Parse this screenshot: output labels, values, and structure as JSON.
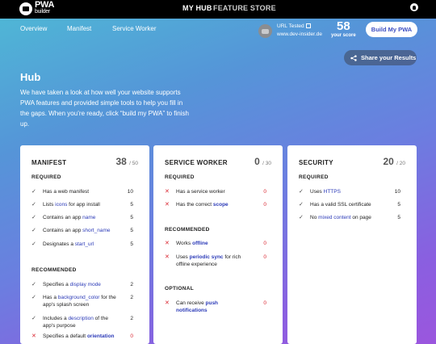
{
  "topbar": {
    "logo_main": "PWA",
    "logo_sub": "builder",
    "nav": [
      "MY HUB",
      "FEATURE STORE"
    ]
  },
  "subbar": {
    "nav": [
      "Overview",
      "Manifest",
      "Service Worker"
    ],
    "url_label": "URL Tested",
    "url_value": "www.dev-insider.de",
    "score_value": "58",
    "score_label": "your score",
    "build_label": "Build My PWA"
  },
  "hero": {
    "share_label": "Share your Results",
    "title": "Hub",
    "description": "We have taken a look at how well your website supports PWA features and provided simple tools to help you fill in the gaps. When you’re ready, click “build my PWA” to finish up."
  },
  "cards": {
    "manifest": {
      "title": "MANIFEST",
      "score": "38",
      "max": "/ 50",
      "required_label": "REQUIRED",
      "recommended_label": "RECOMMENDED",
      "required": [
        {
          "pre": "Has a web manifest",
          "link": "",
          "post": "",
          "pts": "10",
          "ok": true
        },
        {
          "pre": "Lists ",
          "link": "icons",
          "post": " for app install",
          "pts": "5",
          "ok": true
        },
        {
          "pre": "Contains an app ",
          "link": "name",
          "post": "",
          "pts": "5",
          "ok": true
        },
        {
          "pre": "Contains an app ",
          "link": "short_name",
          "post": "",
          "pts": "5",
          "ok": true
        },
        {
          "pre": "Designates a ",
          "link": "start_url",
          "post": "",
          "pts": "5",
          "ok": true
        }
      ],
      "recommended": [
        {
          "pre": "Specifies a ",
          "link": "display mode",
          "post": "",
          "pts": "2",
          "ok": true
        },
        {
          "pre": "Has a ",
          "link": "background_color",
          "post": " for the app's splash screen",
          "pts": "2",
          "ok": true
        },
        {
          "pre": "Includes a ",
          "link": "description",
          "post": " of the app's purpose",
          "pts": "2",
          "ok": true
        },
        {
          "pre": "Specifies a default ",
          "link": "orientation",
          "post": "",
          "pts": "0",
          "ok": false
        }
      ]
    },
    "service_worker": {
      "title": "SERVICE WORKER",
      "score": "0",
      "max": "/ 30",
      "required_label": "REQUIRED",
      "recommended_label": "RECOMMENDED",
      "optional_label": "OPTIONAL",
      "required": [
        {
          "pre": "Has a service worker",
          "link": "",
          "post": "",
          "pts": "0",
          "ok": false
        },
        {
          "pre": "Has the correct ",
          "link": "scope",
          "post": "",
          "pts": "0",
          "ok": false
        }
      ],
      "recommended": [
        {
          "pre": "Works ",
          "link": "offline",
          "post": "",
          "pts": "0",
          "ok": false
        },
        {
          "pre": "Uses ",
          "link": "periodic sync",
          "post": " for rich offline experience",
          "pts": "0",
          "ok": false
        }
      ],
      "optional": [
        {
          "pre": "Can receive ",
          "link": "push notifications",
          "post": "",
          "pts": "0",
          "ok": false
        }
      ]
    },
    "security": {
      "title": "SECURITY",
      "score": "20",
      "max": "/ 20",
      "required_label": "REQUIRED",
      "required": [
        {
          "pre": "Uses ",
          "link": "HTTPS",
          "post": "",
          "pts": "10",
          "ok": true
        },
        {
          "pre": "Has a valid SSL certificate",
          "link": "",
          "post": "",
          "pts": "5",
          "ok": true
        },
        {
          "pre": "No ",
          "link": "mixed content",
          "post": " on page",
          "pts": "5",
          "ok": true
        }
      ]
    }
  }
}
